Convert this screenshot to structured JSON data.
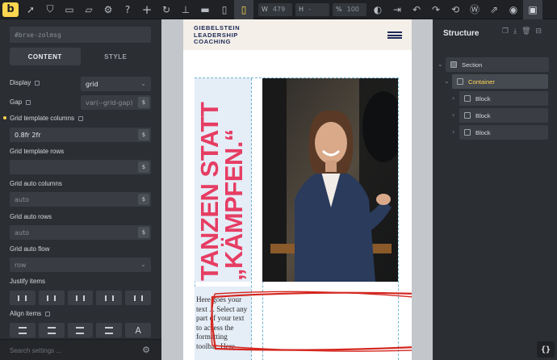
{
  "toolbar": {
    "width_label": "W",
    "width_value": "479",
    "height_label": "H",
    "height_value": "-",
    "zoom_label": "%",
    "zoom_value": "100"
  },
  "left_panel": {
    "element_id": "#brxe-zolmsg",
    "tabs": [
      "CONTENT",
      "STYLE"
    ],
    "props": {
      "display_label": "Display",
      "display_value": "grid",
      "gap_label": "Gap",
      "gap_placeholder": "var(--grid-gap)",
      "grid_template_columns_label": "Grid template columns",
      "grid_template_columns_value": "0.8fr 2fr",
      "grid_template_rows_label": "Grid template rows",
      "grid_auto_columns_label": "Grid auto columns",
      "grid_auto_columns_placeholder": "auto",
      "grid_auto_rows_label": "Grid auto rows",
      "grid_auto_rows_placeholder": "auto",
      "grid_auto_flow_label": "Grid auto flow",
      "grid_auto_flow_placeholder": "row",
      "justify_items_label": "Justify items",
      "align_items_label": "Align items"
    },
    "search_placeholder": "Search settings ..."
  },
  "preview": {
    "logo_lines": [
      "GIEBELSTEIN",
      "LEADERSHIP",
      "COACHING"
    ],
    "headline_line1": "TANZEN STATT",
    "headline_line2": "„KÄMPFEN.“",
    "body_text": "Here goes your text ... Select any part of your text to access the formatting toolbar. Here"
  },
  "structure": {
    "title": "Structure",
    "nodes": [
      {
        "label": "Section"
      },
      {
        "label": "Container"
      },
      {
        "label": "Block"
      },
      {
        "label": "Block"
      },
      {
        "label": "Block"
      }
    ]
  },
  "colors": {
    "accent": "#ffd64f",
    "headline": "#e63d63",
    "brand_navy": "#1d2a55",
    "annotation_red": "#d4261f"
  }
}
